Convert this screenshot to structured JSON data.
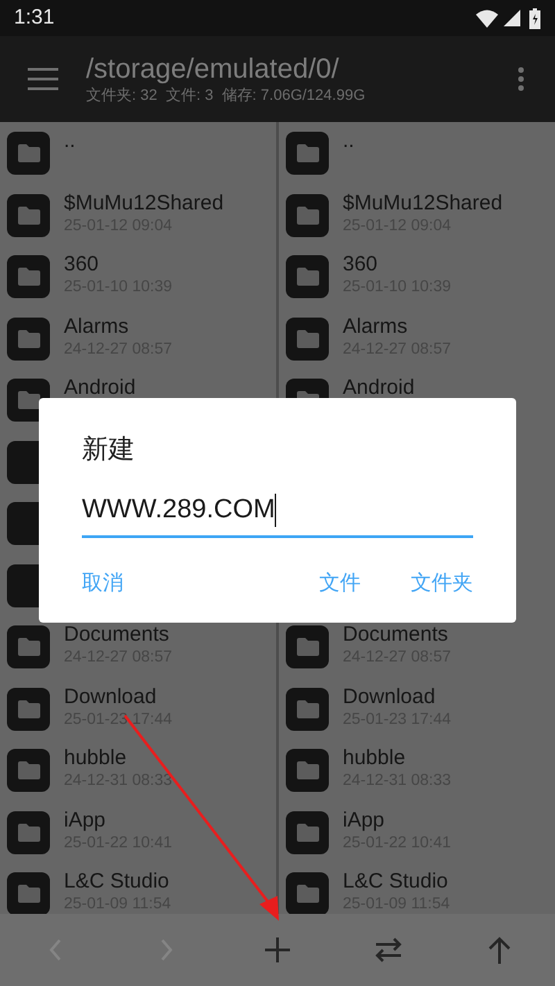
{
  "status_bar": {
    "time": "1:31"
  },
  "toolbar": {
    "path": "/storage/emulated/0/",
    "summary": "文件夹: 32  文件: 3  储存: 7.06G/124.99G"
  },
  "panes": [
    {
      "items": [
        {
          "name": ".."
        },
        {
          "name": "$MuMu12Shared",
          "date": "25-01-12 09:04"
        },
        {
          "name": "360",
          "date": "25-01-10 10:39"
        },
        {
          "name": "Alarms",
          "date": "24-12-27 08:57"
        },
        {
          "name": "Android"
        },
        {
          "covered": true
        },
        {
          "covered": true
        },
        {
          "covered": true
        },
        {
          "name": "Documents",
          "date": "24-12-27 08:57"
        },
        {
          "name": "Download",
          "date": "25-01-23 17:44"
        },
        {
          "name": "hubble",
          "date": "24-12-31 08:33"
        },
        {
          "name": "iApp",
          "date": "25-01-22 10:41"
        },
        {
          "name": "L&C Studio",
          "date": "25-01-09 11:54"
        }
      ]
    },
    {
      "items": [
        {
          "name": ".."
        },
        {
          "name": "$MuMu12Shared",
          "date": "25-01-12 09:04"
        },
        {
          "name": "360",
          "date": "25-01-10 10:39"
        },
        {
          "name": "Alarms",
          "date": "24-12-27 08:57"
        },
        {
          "name": "Android"
        }
      ],
      "items_below_dialog": [
        {
          "name": "Documents",
          "date": "24-12-27 08:57"
        },
        {
          "name": "Download",
          "date": "25-01-23 17:44"
        },
        {
          "name": "hubble",
          "date": "24-12-31 08:33"
        },
        {
          "name": "iApp",
          "date": "25-01-22 10:41"
        },
        {
          "name": "L&C Studio",
          "date": "25-01-09 11:54"
        }
      ]
    }
  ],
  "bottom_bar": [
    {
      "kind": "back",
      "disabled": true
    },
    {
      "kind": "forward",
      "disabled": true
    },
    {
      "kind": "add",
      "disabled": false
    },
    {
      "kind": "swap",
      "disabled": false
    },
    {
      "kind": "up",
      "disabled": false
    }
  ],
  "dialog": {
    "title": "新建",
    "value": "WWW.289.COM",
    "buttons": [
      "取消",
      "文件",
      "文件夹"
    ]
  }
}
